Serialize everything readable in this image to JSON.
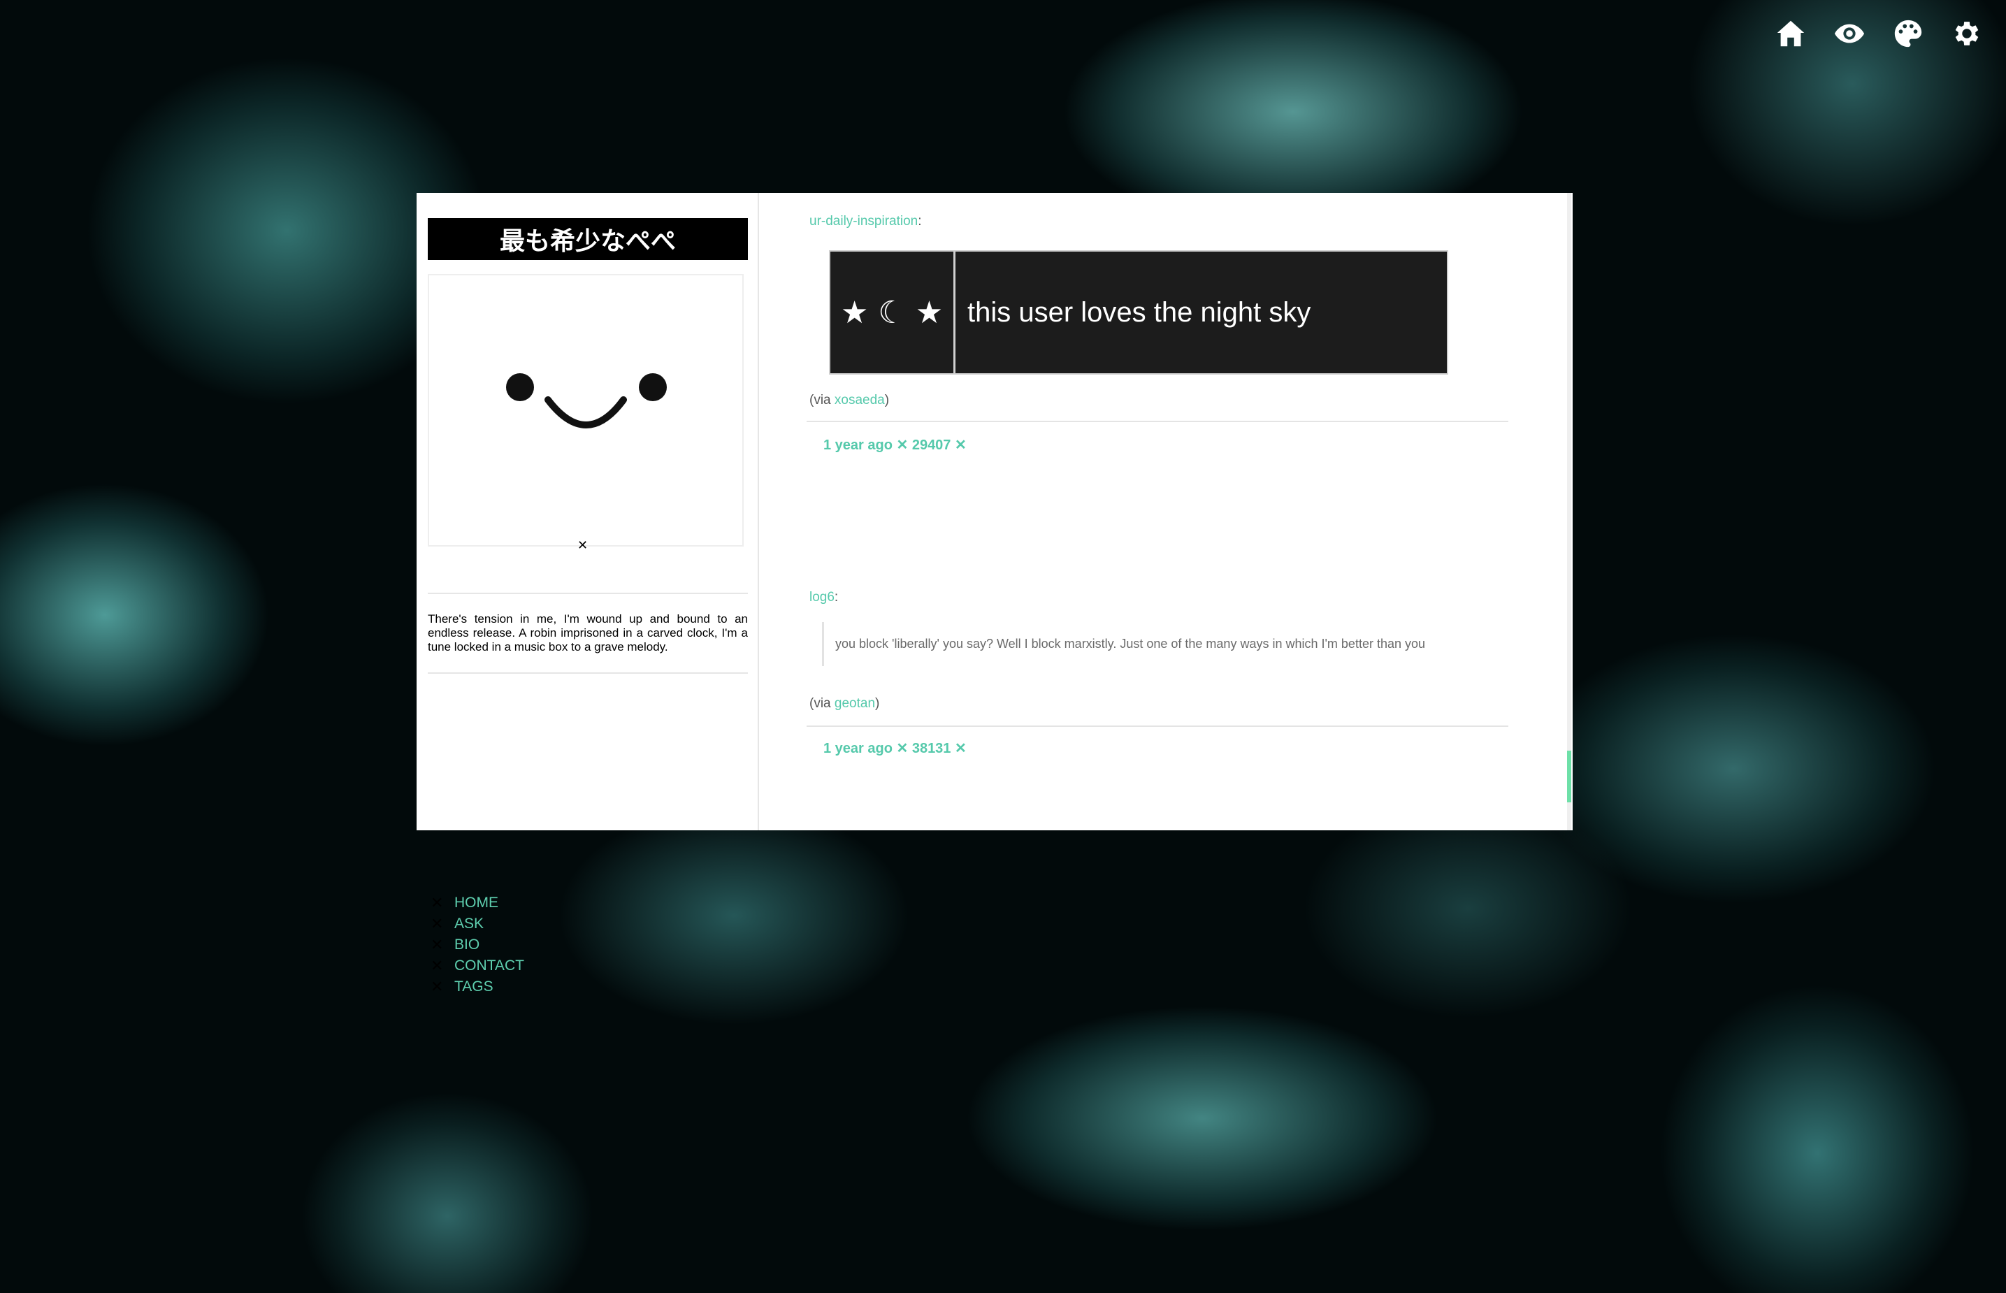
{
  "page": {
    "accent_color": "#55c9ab",
    "background_image": "jellyfish"
  },
  "top_icons": [
    {
      "name": "home-icon"
    },
    {
      "name": "eye-icon"
    },
    {
      "name": "palette-icon"
    },
    {
      "name": "gear-icon"
    }
  ],
  "sidebar": {
    "title": "最も希少なぺぺ",
    "avatar_caption": "✕",
    "bio": "There's tension in me, I'm wound up and bound to an endless release. A robin imprisoned in a carved clock, I'm a tune locked in a music box to a grave melody.",
    "nav_marker": "✕",
    "nav": [
      {
        "label": "HOME"
      },
      {
        "label": "ASK"
      },
      {
        "label": "BIO"
      },
      {
        "label": "CONTACT"
      },
      {
        "label": "TAGS"
      }
    ]
  },
  "posts": [
    {
      "source": "ur-daily-inspiration",
      "image": {
        "symbols": "★ ☾ ★",
        "text": "this user loves the night sky"
      },
      "via_prefix": "(via ",
      "via": "xosaeda",
      "via_suffix": ")",
      "meta": "1 year ago ✕ 29407 ✕"
    },
    {
      "source": "log6",
      "quote": "you block 'liberally' you say? Well I block marxistly. Just one of the many ways in which I'm better than you",
      "via_prefix": "(via ",
      "via": "geotan",
      "via_suffix": ")",
      "meta": "1 year ago ✕ 38131 ✕"
    }
  ]
}
